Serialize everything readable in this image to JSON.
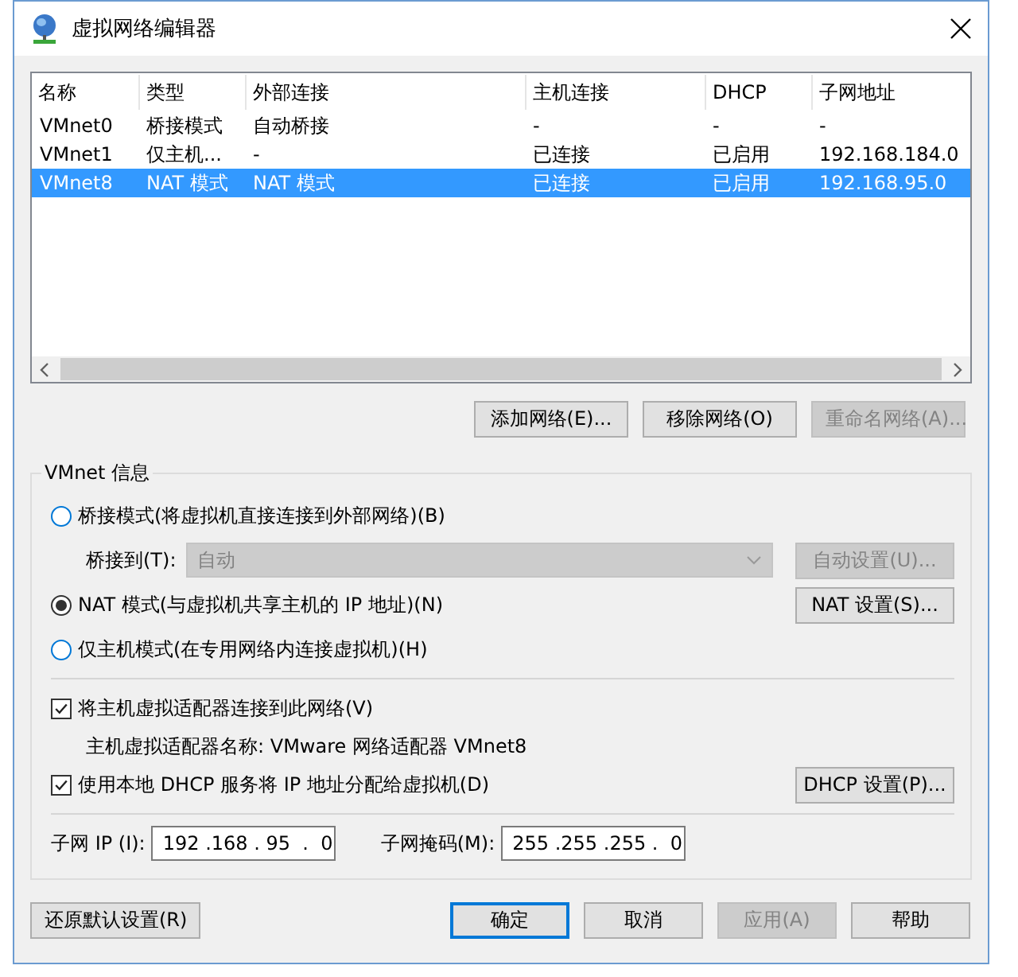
{
  "window": {
    "title": "虚拟网络编辑器"
  },
  "table": {
    "columns": [
      "名称",
      "类型",
      "外部连接",
      "主机连接",
      "DHCP",
      "子网地址"
    ],
    "rows": [
      {
        "cells": [
          "VMnet0",
          "桥接模式",
          "自动桥接",
          "-",
          "-",
          "-"
        ],
        "selected": false
      },
      {
        "cells": [
          "VMnet1",
          "仅主机...",
          "-",
          "已连接",
          "已启用",
          "192.168.184.0"
        ],
        "selected": false
      },
      {
        "cells": [
          "VMnet8",
          "NAT 模式",
          "NAT 模式",
          "已连接",
          "已启用",
          "192.168.95.0"
        ],
        "selected": true
      }
    ]
  },
  "network_buttons": [
    {
      "label": "添加网络(E)...",
      "disabled": false
    },
    {
      "label": "移除网络(O)",
      "disabled": false
    },
    {
      "label": "重命名网络(A)...",
      "disabled": true
    }
  ],
  "vmnet_info": {
    "label": "VMnet 信息",
    "modes": [
      {
        "label": "桥接模式(将虚拟机直接连接到外部网络)(B)",
        "selected": false
      },
      {
        "label": "NAT 模式(与虚拟机共享主机的 IP 地址)(N)",
        "selected": true
      },
      {
        "label": "仅主机模式(在专用网络内连接虚拟机)(H)",
        "selected": false
      }
    ],
    "bridge_to": {
      "label": "桥接到(T):",
      "value": "自动",
      "disabled": true
    },
    "auto_settings": {
      "label": "自动设置(U)...",
      "disabled": true
    },
    "nat_settings": {
      "label": "NAT 设置(S)...",
      "disabled": false
    },
    "connect_adapter": {
      "label": "将主机虚拟适配器连接到此网络(V)",
      "checked": true
    },
    "adapter_name": "主机虚拟适配器名称: VMware 网络适配器 VMnet8",
    "use_dhcp": {
      "label": "使用本地 DHCP 服务将 IP 地址分配给虚拟机(D)",
      "checked": true
    },
    "dhcp_settings": {
      "label": "DHCP 设置(P)...",
      "disabled": false
    },
    "subnet_ip": {
      "label": "子网 IP (I):",
      "value": "192 .168 . 95  .  0"
    },
    "subnet_mask": {
      "label": "子网掩码(M):",
      "value": "255 .255 .255 .  0"
    }
  },
  "footer_buttons": [
    {
      "label": "还原默认设置(R)",
      "disabled": false,
      "default": false
    },
    {
      "label": "确定",
      "disabled": false,
      "default": true
    },
    {
      "label": "取消",
      "disabled": false,
      "default": false
    },
    {
      "label": "应用(A)",
      "disabled": true,
      "default": false
    },
    {
      "label": "帮助",
      "disabled": false,
      "default": false
    }
  ]
}
